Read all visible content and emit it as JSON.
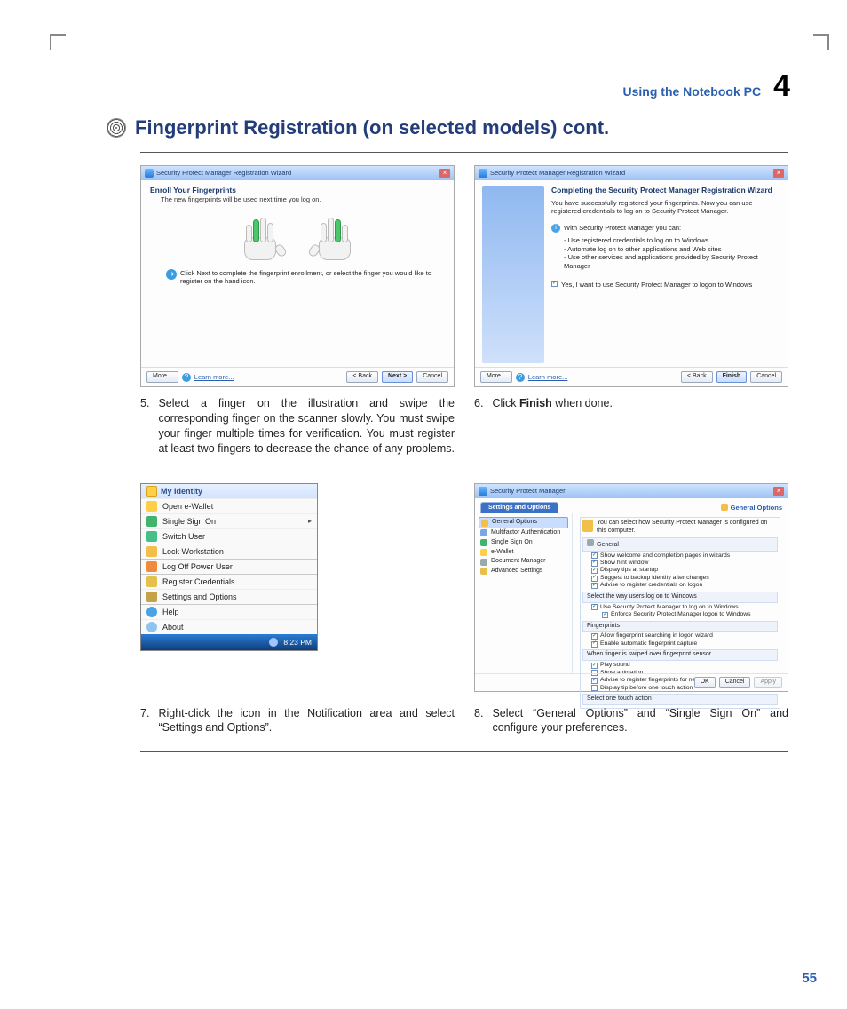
{
  "chapter": {
    "title": "Using the Notebook PC",
    "number": "4"
  },
  "section_title": "Fingerprint Registration (on selected models) cont.",
  "page_number": "55",
  "step5": {
    "window_title": "Security Protect Manager Registration Wizard",
    "heading": "Enroll Your Fingerprints",
    "subheading": "The new fingerprints will be used next time you log on.",
    "hint_line": "Click Next to complete the fingerprint enrollment, or select the finger you would like to register on the hand icon.",
    "buttons": {
      "more": "More...",
      "learn": "Learn more...",
      "back": "< Back",
      "next": "Next >",
      "cancel": "Cancel"
    },
    "caption_num": "5.",
    "caption": "Select a finger on the illustration and swipe the corresponding finger on the scanner slowly. You must swipe your finger multiple times for verification. You must register at least two fingers to decrease the chance of any problems."
  },
  "step6": {
    "window_title": "Security Protect Manager Registration Wizard",
    "heading": "Completing the Security Protect Manager Registration Wizard",
    "subheading": "You have successfully registered your fingerprints. Now you can use registered credentials to log on to Security Protect Manager.",
    "info_line": "With Security Protect Manager you can:",
    "bullets": [
      "Use registered credentials to log on to Windows",
      "Automate log on to other applications and Web sites",
      "Use other services and applications provided by Security Protect Manager"
    ],
    "checkbox": "Yes, I want to use Security Protect Manager to logon to Windows",
    "buttons": {
      "more": "More...",
      "learn": "Learn more...",
      "back": "< Back",
      "finish": "Finish",
      "cancel": "Cancel"
    },
    "caption_num": "6.",
    "caption_pre": "Click ",
    "caption_bold": "Finish",
    "caption_post": " when done."
  },
  "step7": {
    "menu_title": "My Identity",
    "items": [
      "Open e-Wallet",
      "Single Sign On",
      "Switch User",
      "Lock Workstation",
      "Log Off Power User",
      "Register Credentials",
      "Settings and Options",
      "Help",
      "About"
    ],
    "clock": "8:23 PM",
    "caption_num": "7.",
    "caption": "Right-click the icon in the Notification area and select “Settings and Options”."
  },
  "step8": {
    "window_title": "Security Protect Manager",
    "tab_left": "Settings and Options",
    "tab_right": "General Options",
    "left_items": [
      "General Options",
      "Multifactor Authentication",
      "Single Sign On",
      "e-Wallet",
      "Document Manager",
      "Advanced Settings"
    ],
    "right_header": "General",
    "intro": "You can select how Security Protect Manager is configured on this computer.",
    "group_general": "General",
    "general_items": [
      "Show welcome and completion pages in wizards",
      "Show hint window",
      "Display tips at startup",
      "Suggest to backup identity after changes",
      "Advise to register credentials on logon"
    ],
    "group_logon": "Select the way users log on to Windows",
    "logon_items": [
      "Use Security Protect Manager to log on to Windows",
      "Enforce Security Protect Manager logon to Windows"
    ],
    "group_fp": "Fingerprints",
    "fp_items": [
      "Allow fingerprint searching in logon wizard",
      "Enable automatic fingerprint capture"
    ],
    "group_swipe": "When finger is swiped over fingerprint sensor",
    "swipe_items": [
      "Play sound",
      "Show animation",
      "Advise to register fingerprints for new users",
      "Display tip before one touch action"
    ],
    "group_select": "Select one touch action",
    "buttons": {
      "ok": "OK",
      "cancel": "Cancel",
      "apply": "Apply"
    },
    "caption_num": "8.",
    "caption": "Select “General Options” and “Single Sign On” and configure your preferences."
  }
}
